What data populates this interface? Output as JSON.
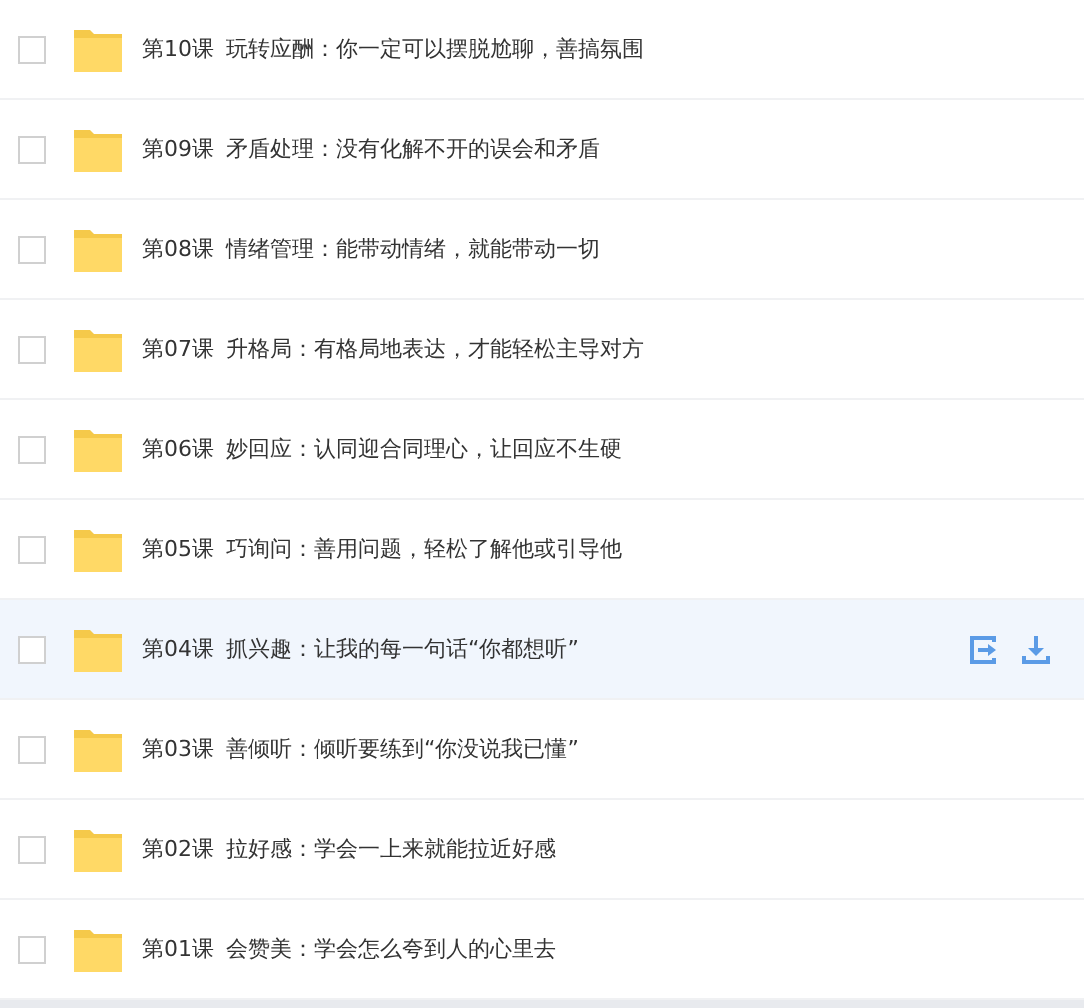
{
  "files": [
    {
      "lesson": "第10课",
      "title": "玩转应酬：你一定可以摆脱尬聊，善搞氛围",
      "checked": false,
      "hovered": false
    },
    {
      "lesson": "第09课",
      "title": "矛盾处理：没有化解不开的误会和矛盾",
      "checked": false,
      "hovered": false
    },
    {
      "lesson": "第08课",
      "title": "情绪管理：能带动情绪，就能带动一切",
      "checked": false,
      "hovered": false
    },
    {
      "lesson": "第07课",
      "title": "升格局：有格局地表达，才能轻松主导对方",
      "checked": false,
      "hovered": false
    },
    {
      "lesson": "第06课",
      "title": "妙回应：认同迎合同理心，让回应不生硬",
      "checked": false,
      "hovered": false
    },
    {
      "lesson": "第05课",
      "title": "巧询问：善用问题，轻松了解他或引导他",
      "checked": false,
      "hovered": false
    },
    {
      "lesson": "第04课",
      "title": "抓兴趣：让我的每一句话“你都想听”",
      "checked": false,
      "hovered": true
    },
    {
      "lesson": "第03课",
      "title": "善倾听：倾听要练到“你没说我已懂”",
      "checked": false,
      "hovered": false
    },
    {
      "lesson": "第02课",
      "title": "拉好感：学会一上来就能拉近好感",
      "checked": false,
      "hovered": false
    },
    {
      "lesson": "第01课",
      "title": "会赞美：学会怎么夸到人的心里去",
      "checked": false,
      "hovered": false
    }
  ]
}
